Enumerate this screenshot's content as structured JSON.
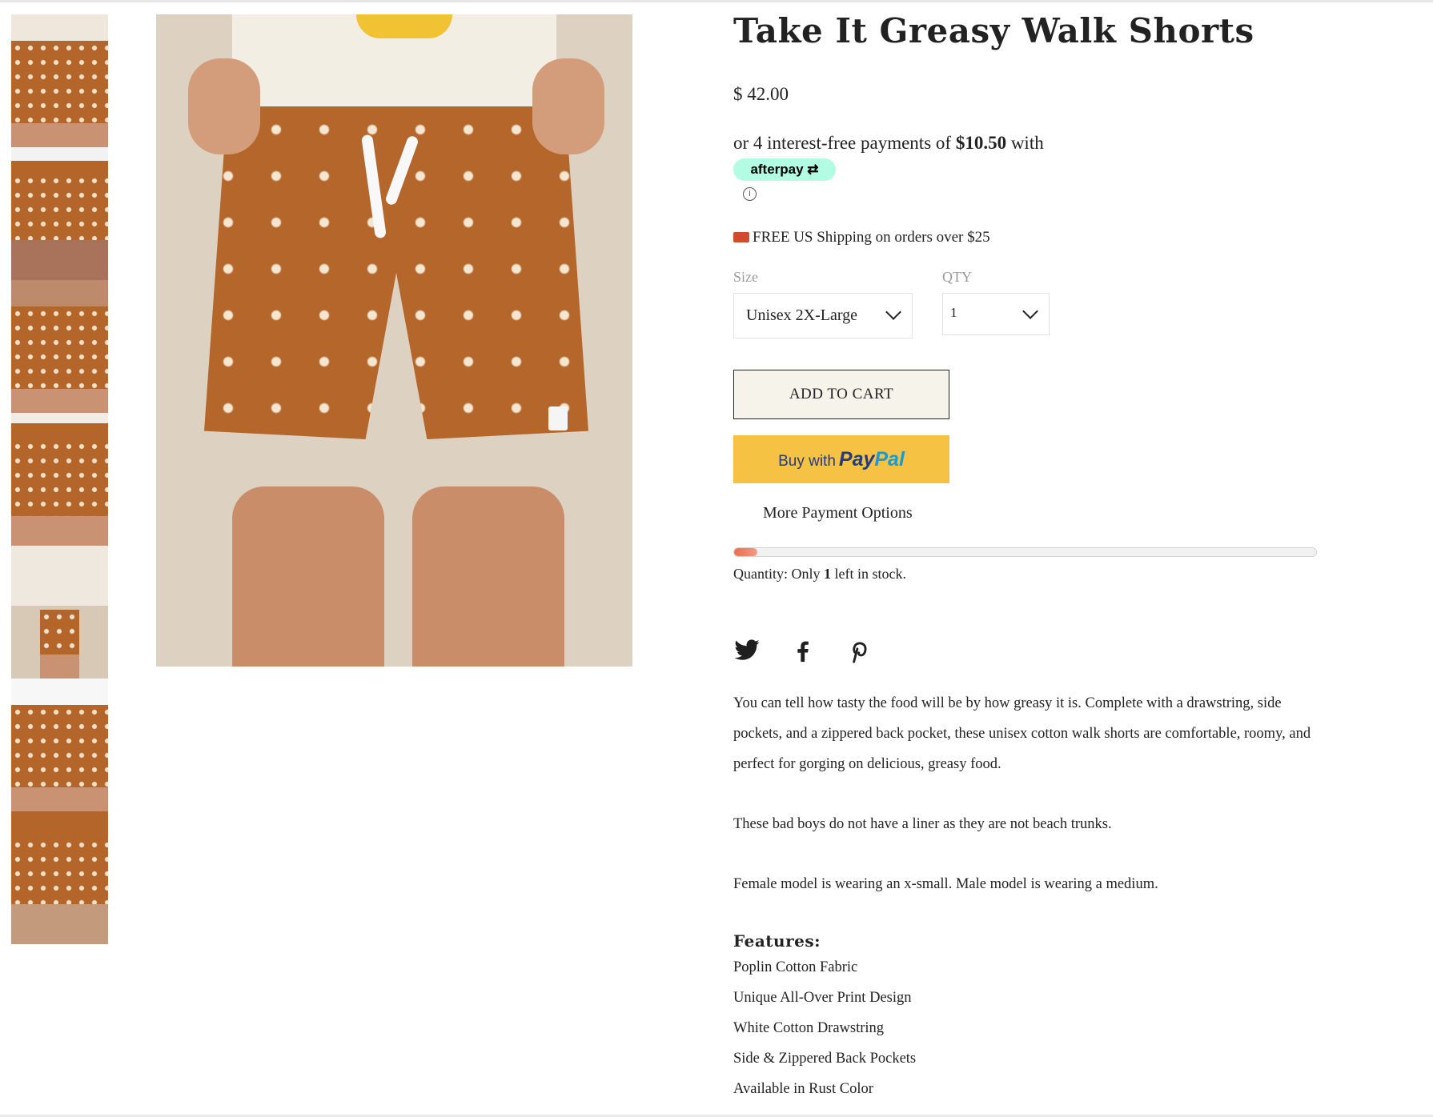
{
  "product": {
    "title": "Take It Greasy Walk Shorts",
    "price": "$ 42.00"
  },
  "afterpay": {
    "prefix": "or 4 interest-free payments of",
    "amount": "$10.50",
    "suffix": "with",
    "badge_text": "afterpay",
    "badge_color": "#b2fce4",
    "info_icon": "info-circle-icon"
  },
  "shipping": {
    "icon": "truck-icon",
    "text": "FREE US Shipping on orders over $25"
  },
  "size": {
    "label": "Size",
    "selected": "Unisex 2X-Large"
  },
  "qty": {
    "label": "QTY",
    "selected": "1"
  },
  "buttons": {
    "add_to_cart": "ADD TO CART",
    "paypal_prefix": "Buy with",
    "paypal_brand_1": "Pay",
    "paypal_brand_2": "Pal",
    "more_payment": "More Payment Options"
  },
  "stock": {
    "level_fraction": 0.04,
    "prefix": "Quantity: Only",
    "count": "1",
    "suffix": "left in stock.",
    "bar_color": "#f2694e"
  },
  "social": [
    {
      "name": "twitter-icon"
    },
    {
      "name": "facebook-icon"
    },
    {
      "name": "pinterest-icon"
    }
  ],
  "description": [
    "You can tell how tasty the food will be by how greasy it is. Complete with a drawstring, side pockets, and a zippered back pocket, these unisex cotton walk shorts are comfortable, roomy, and perfect for gorging on delicious, greasy food.",
    "These bad boys do not have a liner as they are not beach trunks.",
    "Female model is wearing an x-small. Male model is wearing a medium."
  ],
  "features": {
    "title": "Features:",
    "items": [
      "Poplin Cotton Fabric",
      "Unique All-Over Print Design",
      "White Cotton Drawstring",
      "Side & Zippered Back Pockets",
      "Available in Rust Color"
    ]
  },
  "thumbnails": 7
}
